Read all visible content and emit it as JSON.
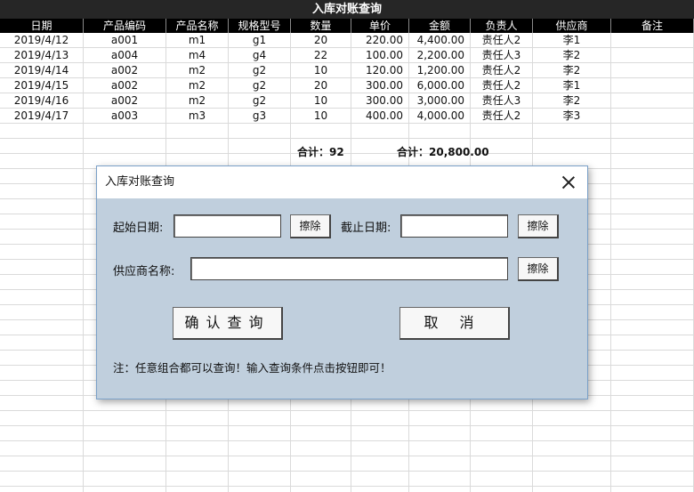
{
  "sheet_title": "入库对账查询",
  "headers": [
    "日期",
    "产品编码",
    "产品名称",
    "规格型号",
    "数量",
    "单价",
    "金额",
    "负责人",
    "供应商",
    "备注"
  ],
  "rows": [
    {
      "date": "2019/4/12",
      "code": "a001",
      "name": "m1",
      "spec": "g1",
      "qty": "20",
      "price": "220.00",
      "amount": "4,400.00",
      "owner": "责任人2",
      "supplier": "李1",
      "remark": ""
    },
    {
      "date": "2019/4/13",
      "code": "a004",
      "name": "m4",
      "spec": "g4",
      "qty": "22",
      "price": "100.00",
      "amount": "2,200.00",
      "owner": "责任人3",
      "supplier": "李2",
      "remark": ""
    },
    {
      "date": "2019/4/14",
      "code": "a002",
      "name": "m2",
      "spec": "g2",
      "qty": "10",
      "price": "120.00",
      "amount": "1,200.00",
      "owner": "责任人2",
      "supplier": "李2",
      "remark": ""
    },
    {
      "date": "2019/4/15",
      "code": "a002",
      "name": "m2",
      "spec": "g2",
      "qty": "20",
      "price": "300.00",
      "amount": "6,000.00",
      "owner": "责任人2",
      "supplier": "李1",
      "remark": ""
    },
    {
      "date": "2019/4/16",
      "code": "a002",
      "name": "m2",
      "spec": "g2",
      "qty": "10",
      "price": "300.00",
      "amount": "3,000.00",
      "owner": "责任人3",
      "supplier": "李2",
      "remark": ""
    },
    {
      "date": "2019/4/17",
      "code": "a003",
      "name": "m3",
      "spec": "g3",
      "qty": "10",
      "price": "400.00",
      "amount": "4,000.00",
      "owner": "责任人2",
      "supplier": "李3",
      "remark": ""
    }
  ],
  "totals": {
    "qty": "合计：92",
    "amount": "合计：20,800.00"
  },
  "dialog": {
    "title": "入库对账查询",
    "start_label": "起始日期:",
    "end_label": "截止日期:",
    "supplier_label": "供应商名称:",
    "start_value": "",
    "end_value": "",
    "supplier_value": "",
    "clear_label": "擦除",
    "confirm_label": "确认查询",
    "cancel_label": "取消",
    "note": "注：任意组合都可以查询！输入查询条件点击按钮即可！"
  }
}
